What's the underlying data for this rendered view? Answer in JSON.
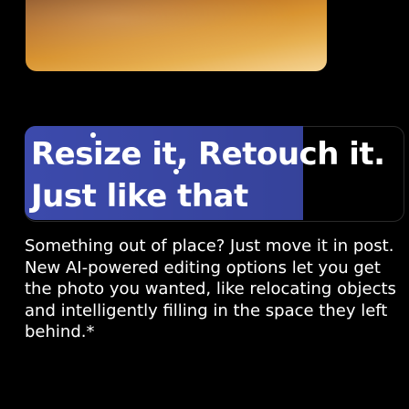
{
  "banner": {
    "headline_line1": "Resize it, Retouch it.",
    "headline_line2": "Just like that"
  },
  "description": {
    "text": "Something out of place? Just move it in post. New AI-powered editing options let you get the photo you wanted, like relocating objects and intelligently filling in the space they left behind.*"
  }
}
